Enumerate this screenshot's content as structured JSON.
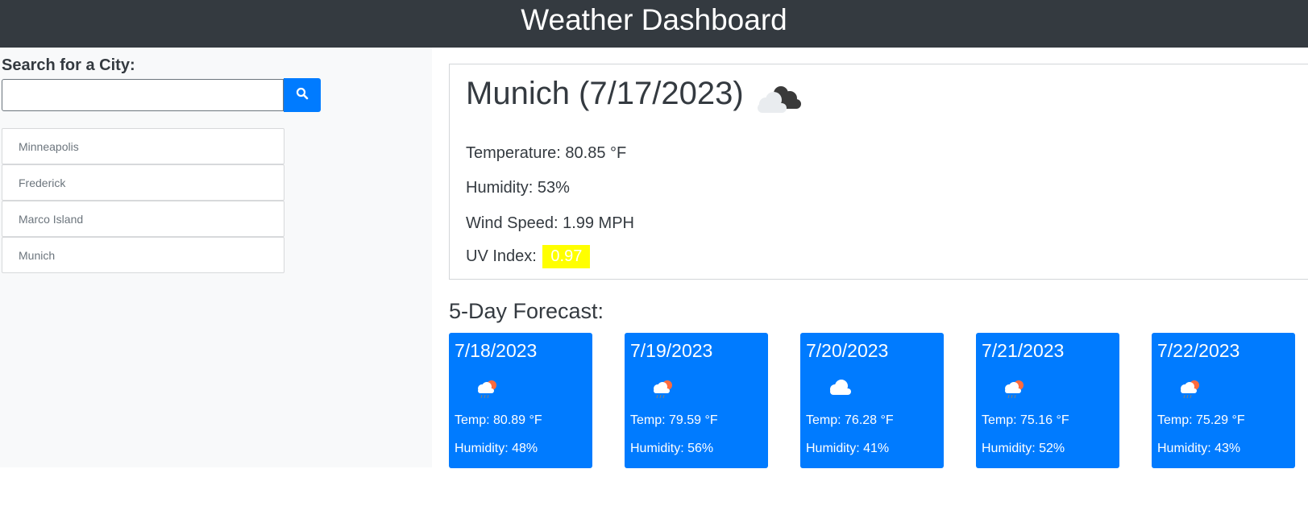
{
  "header": {
    "title": "Weather Dashboard"
  },
  "search": {
    "label": "Search for a City:",
    "value": "",
    "placeholder": ""
  },
  "history": [
    "Minneapolis",
    "Frederick",
    "Marco Island",
    "Munich"
  ],
  "current": {
    "title": "Munich (7/17/2023)",
    "icon": "broken-clouds-icon",
    "temperature": "Temperature: 80.85 °F",
    "humidity": "Humidity: 53%",
    "wind": "Wind Speed: 1.99 MPH",
    "uv_label": "UV Index:",
    "uv_value": "0.97"
  },
  "forecast": {
    "title": "5-Day Forecast:",
    "days": [
      {
        "date": "7/18/2023",
        "icon": "rain-sun-icon",
        "temp": "Temp: 80.89 °F",
        "humidity": "Humidity: 48%"
      },
      {
        "date": "7/19/2023",
        "icon": "rain-sun-icon",
        "temp": "Temp: 79.59 °F",
        "humidity": "Humidity: 56%"
      },
      {
        "date": "7/20/2023",
        "icon": "cloud-icon",
        "temp": "Temp: 76.28 °F",
        "humidity": "Humidity: 41%"
      },
      {
        "date": "7/21/2023",
        "icon": "rain-sun-icon",
        "temp": "Temp: 75.16 °F",
        "humidity": "Humidity: 52%"
      },
      {
        "date": "7/22/2023",
        "icon": "rain-sun-icon",
        "temp": "Temp: 75.29 °F",
        "humidity": "Humidity: 43%"
      }
    ]
  },
  "colors": {
    "header_bg": "#343a40",
    "accent": "#007bff",
    "uv_badge": "#ffff00",
    "sidebar_bg": "#f8f9fa"
  }
}
